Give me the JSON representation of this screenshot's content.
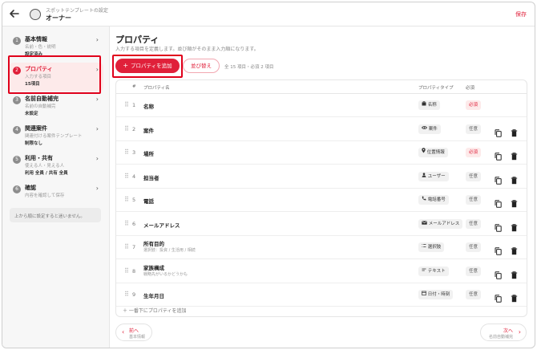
{
  "header": {
    "subtitle": "スポットテンプレートの設定",
    "title": "オーナー",
    "save_label": "保存"
  },
  "sidebar": {
    "steps": [
      {
        "num": "1",
        "title": "基本情報",
        "desc": "名前・色・説明",
        "status": "設定済み"
      },
      {
        "num": "2",
        "title": "プロパティ",
        "desc": "入力する項目",
        "status": "15項目"
      },
      {
        "num": "3",
        "title": "名前自動補完",
        "desc": "名前の自動補完",
        "status": "未設定"
      },
      {
        "num": "4",
        "title": "関連案件",
        "desc": "関連付ける案件テンプレート",
        "status": "制限なし"
      },
      {
        "num": "5",
        "title": "利用・共有",
        "desc": "使える人・見える人",
        "status": "利用 全員 / 共有 全員"
      },
      {
        "num": "6",
        "title": "確認",
        "desc": "内容を確認して保存",
        "status": ""
      }
    ],
    "hint": "上から順に設定すると迷いません。"
  },
  "main": {
    "title": "プロパティ",
    "desc": "入力する項目を定義します。並び順がそのまま入力順になります。",
    "add_label": "プロパティを追加",
    "sort_label": "並び替え",
    "count": "全 15 項目・必須 2 項目",
    "columns": {
      "num": "#",
      "name": "プロパティ名",
      "type": "プロパティタイプ",
      "required": "必須"
    },
    "rows": [
      {
        "num": "1",
        "name": "名称",
        "sub": "",
        "type": "名称",
        "type_icon": "briefcase-icon",
        "required": "必須",
        "is_required": true,
        "actions": false
      },
      {
        "num": "2",
        "name": "案件",
        "sub": "",
        "type": "案件",
        "type_icon": "link-icon",
        "required": "任意",
        "is_required": false,
        "actions": true
      },
      {
        "num": "3",
        "name": "場所",
        "sub": "",
        "type": "位置情報",
        "type_icon": "location-pin-icon",
        "required": "必須",
        "is_required": true,
        "actions": true
      },
      {
        "num": "4",
        "name": "担当者",
        "sub": "",
        "type": "ユーザー",
        "type_icon": "user-icon",
        "required": "任意",
        "is_required": false,
        "actions": true
      },
      {
        "num": "5",
        "name": "電話",
        "sub": "",
        "type": "電話番号",
        "type_icon": "phone-icon",
        "required": "任意",
        "is_required": false,
        "actions": true
      },
      {
        "num": "6",
        "name": "メールアドレス",
        "sub": "",
        "type": "メールアドレス",
        "type_icon": "mail-icon",
        "required": "任意",
        "is_required": false,
        "actions": true
      },
      {
        "num": "7",
        "name": "所有目的",
        "sub": "選択肢：投資 / 生活用 / 相続",
        "type": "選択肢",
        "type_icon": "list-icon",
        "required": "任意",
        "is_required": false,
        "actions": true
      },
      {
        "num": "8",
        "name": "家族構成",
        "sub": "戦略先がいるかどうかも",
        "type": "テキスト",
        "type_icon": "text-icon",
        "required": "任意",
        "is_required": false,
        "actions": true
      },
      {
        "num": "9",
        "name": "生年月日",
        "sub": "",
        "type": "日付・時刻",
        "type_icon": "calendar-icon",
        "required": "任意",
        "is_required": false,
        "actions": true
      }
    ],
    "add_bottom_label": "＋ 一番下にプロパティを追加"
  },
  "footer": {
    "prev_label": "前へ",
    "prev_sub": "基本情報",
    "next_label": "次へ",
    "next_sub": "名前自動補完"
  },
  "colors": {
    "accent": "#e0203a",
    "highlight": "#e0001b",
    "active_bg": "#fdeaea"
  }
}
